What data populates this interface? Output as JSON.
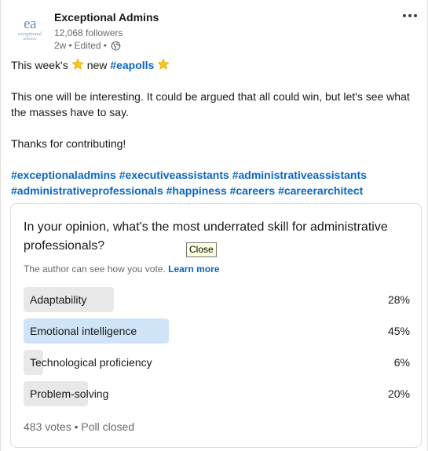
{
  "post": {
    "author": {
      "logo_monogram": "ea",
      "logo_line1": "exceptional",
      "logo_line2": "admins",
      "name": "Exceptional Admins",
      "followers": "12,068 followers",
      "time": "2w",
      "separator": "•",
      "edited": "Edited",
      "visibility_icon": "globe-icon"
    },
    "menu_icon": "more-options-icon",
    "body": {
      "line1_before": "This week's",
      "line1_new": "new",
      "line1_tag": "#eapolls",
      "star_icon": "star-emoji-icon",
      "paragraph2": "This one will be interesting. It could be argued that all could win, but let's see what the masses have to say.",
      "paragraph3": "Thanks for contributing!",
      "hashtags_line1": [
        "#exceptionaladmins",
        "#executiveassistants",
        "#administrativeassistants"
      ],
      "hashtags_line2": [
        "#administrativeprofessionals",
        "#happiness",
        "#careers",
        "#careerarchitect"
      ]
    }
  },
  "poll": {
    "question": "In your opinion, what's the most underrated skill for administrative professionals?",
    "tooltip": "Close",
    "note": "The author can see how you vote.",
    "learn_more": "Learn more",
    "options": [
      {
        "label": "Adaptability",
        "percent_text": "28%",
        "percent": 28,
        "selected": false
      },
      {
        "label": "Emotional intelligence",
        "percent_text": "45%",
        "percent": 45,
        "selected": true
      },
      {
        "label": "Technological proficiency",
        "percent_text": "6%",
        "percent": 6,
        "selected": false
      },
      {
        "label": "Problem-solving",
        "percent_text": "20%",
        "percent": 20,
        "selected": false
      }
    ],
    "votes": "483 votes",
    "separator": "•",
    "status": "Poll closed"
  },
  "colors": {
    "link": "#0a66c2",
    "bar": "#e8e8e8",
    "bar_selected": "#d0e4f7",
    "star": "#f5c518"
  }
}
